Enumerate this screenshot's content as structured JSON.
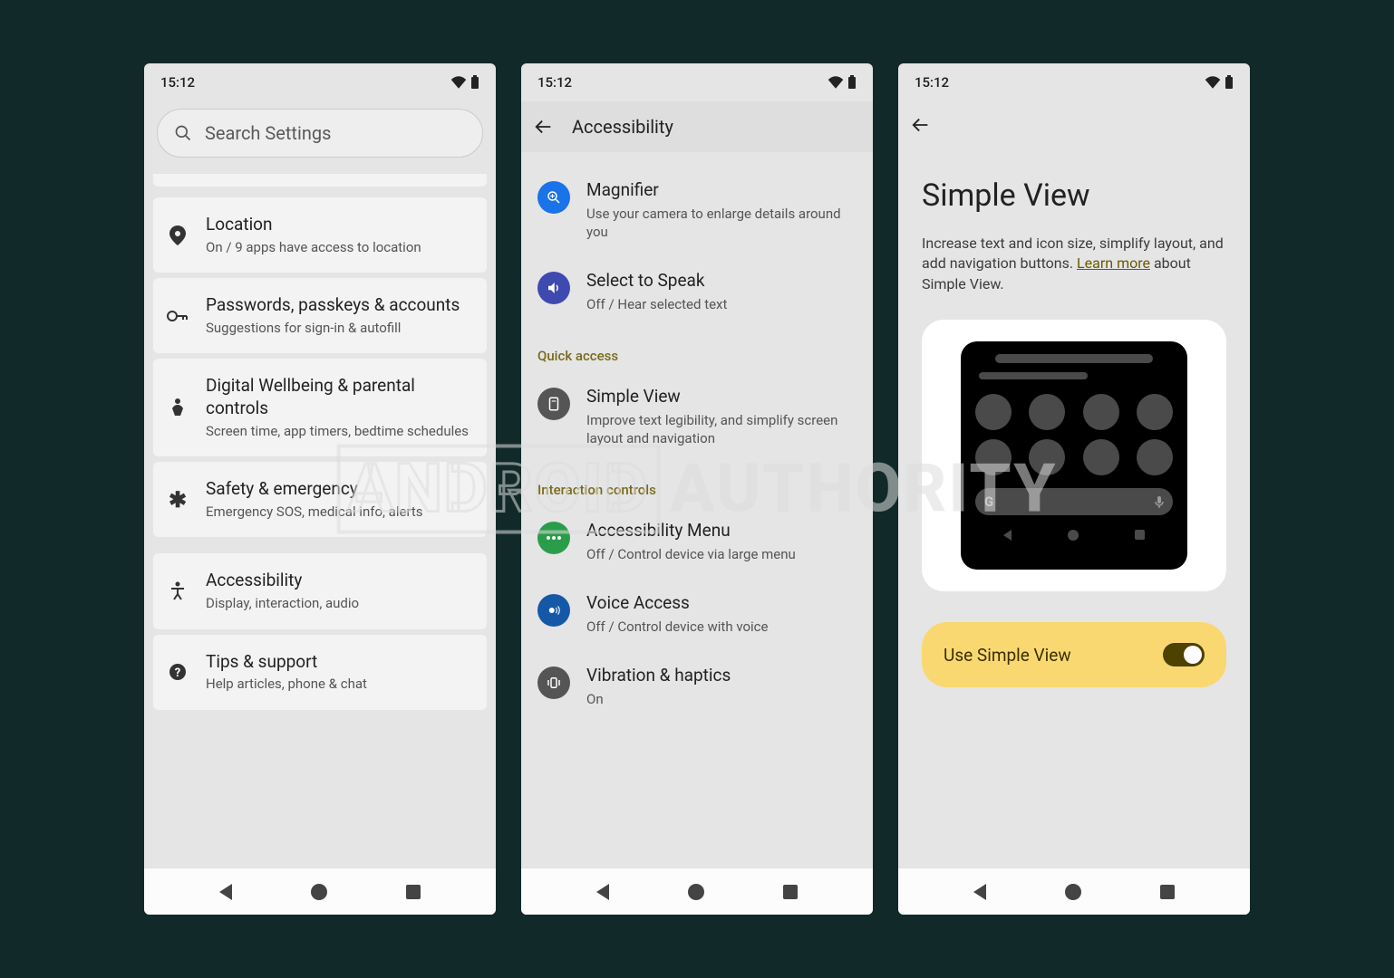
{
  "status": {
    "time": "15:12"
  },
  "watermark": {
    "left": "ANDROID",
    "right": "AUTHORITY"
  },
  "screen1": {
    "search_placeholder": "Search Settings",
    "items": [
      {
        "title": "Location",
        "sub": "On / 9 apps have access to location"
      },
      {
        "title": "Passwords, passkeys & accounts",
        "sub": "Suggestions for sign-in & autofill"
      },
      {
        "title": "Digital Wellbeing & parental controls",
        "sub": "Screen time, app timers, bedtime schedules"
      },
      {
        "title": "Safety & emergency",
        "sub": "Emergency SOS, medical info, alerts"
      },
      {
        "title": "Accessibility",
        "sub": "Display, interaction, audio"
      },
      {
        "title": "Tips & support",
        "sub": "Help articles, phone & chat"
      }
    ]
  },
  "screen2": {
    "header": "Accessibility",
    "top": [
      {
        "title": "Magnifier",
        "sub": "Use your camera to enlarge details around you"
      },
      {
        "title": "Select to Speak",
        "sub": "Off / Hear selected text"
      }
    ],
    "quick_label": "Quick access",
    "quick": [
      {
        "title": "Simple View",
        "sub": "Improve text legibility, and simplify screen layout and navigation"
      }
    ],
    "interact_label": "Interaction controls",
    "interact": [
      {
        "title": "Accessibility Menu",
        "sub": "Off / Control device via large menu"
      },
      {
        "title": "Voice Access",
        "sub": "Off / Control device with voice"
      },
      {
        "title": "Vibration & haptics",
        "sub": "On"
      }
    ]
  },
  "screen3": {
    "title": "Simple View",
    "desc_pre": "Increase text and icon size, simplify layout, and add navigation buttons. ",
    "link": "Learn more",
    "desc_post": " about Simple View.",
    "toggle_label": "Use Simple View",
    "toggle_on": true,
    "mock_search_letter": "G"
  }
}
